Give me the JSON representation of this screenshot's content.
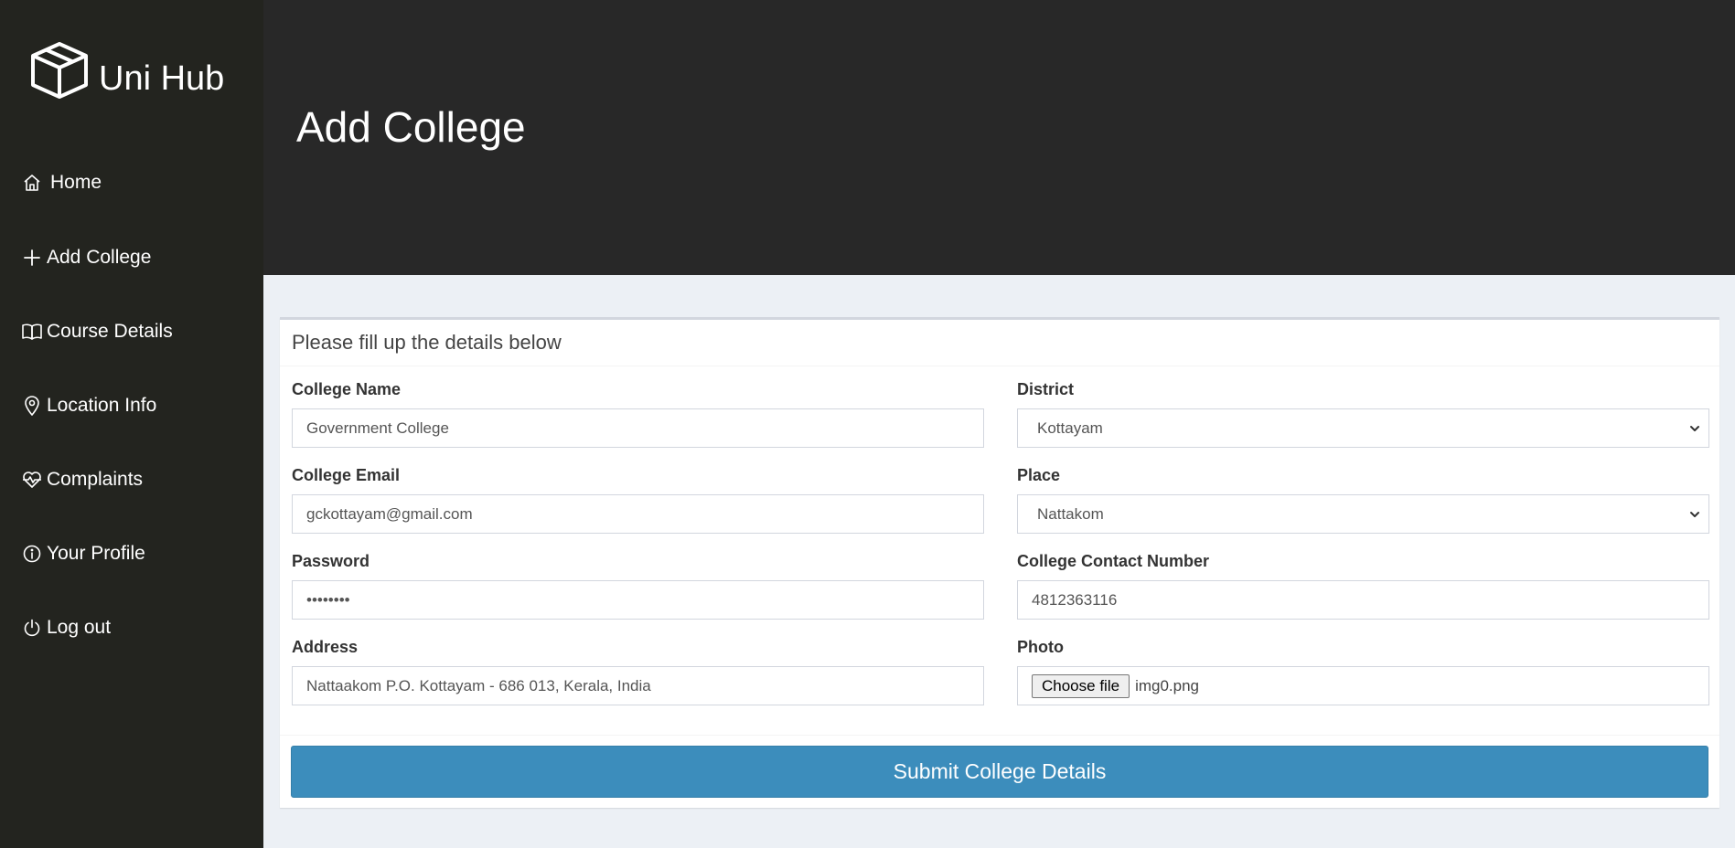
{
  "app": {
    "brand_name": "Uni Hub",
    "brand_icon": "box-icon"
  },
  "sidebar": {
    "items": [
      {
        "label": "Home",
        "icon": "house-icon"
      },
      {
        "label": "Add College",
        "icon": "plus-icon"
      },
      {
        "label": "Course Details",
        "icon": "book-icon"
      },
      {
        "label": "Location Info",
        "icon": "map-pin-icon"
      },
      {
        "label": "Complaints",
        "icon": "heart-pulse-icon"
      },
      {
        "label": "Your Profile",
        "icon": "info-icon"
      },
      {
        "label": "Log out",
        "icon": "power-icon"
      }
    ]
  },
  "header": {
    "title": "Add College"
  },
  "form": {
    "heading": "Please fill up the details below",
    "college_name": {
      "label": "College Name",
      "value": "Government College"
    },
    "college_email": {
      "label": "College Email",
      "value": "gckottayam@gmail.com"
    },
    "password": {
      "label": "Password",
      "value": "••••••••"
    },
    "address": {
      "label": "Address",
      "value": "Nattaakom P.O. Kottayam - 686 013, Kerala, India"
    },
    "district": {
      "label": "District",
      "value": "Kottayam"
    },
    "place": {
      "label": "Place",
      "value": "Nattakom"
    },
    "contact": {
      "label": "College Contact Number",
      "value": "4812363116"
    },
    "photo": {
      "label": "Photo",
      "button_label": "Choose file",
      "file_name": "img0.png"
    },
    "submit_label": "Submit College Details"
  },
  "colors": {
    "sidebar_bg": "#23241f",
    "header_bg": "#282828",
    "page_bg": "#ecf0f5",
    "primary_button": "#3c8dbc"
  }
}
